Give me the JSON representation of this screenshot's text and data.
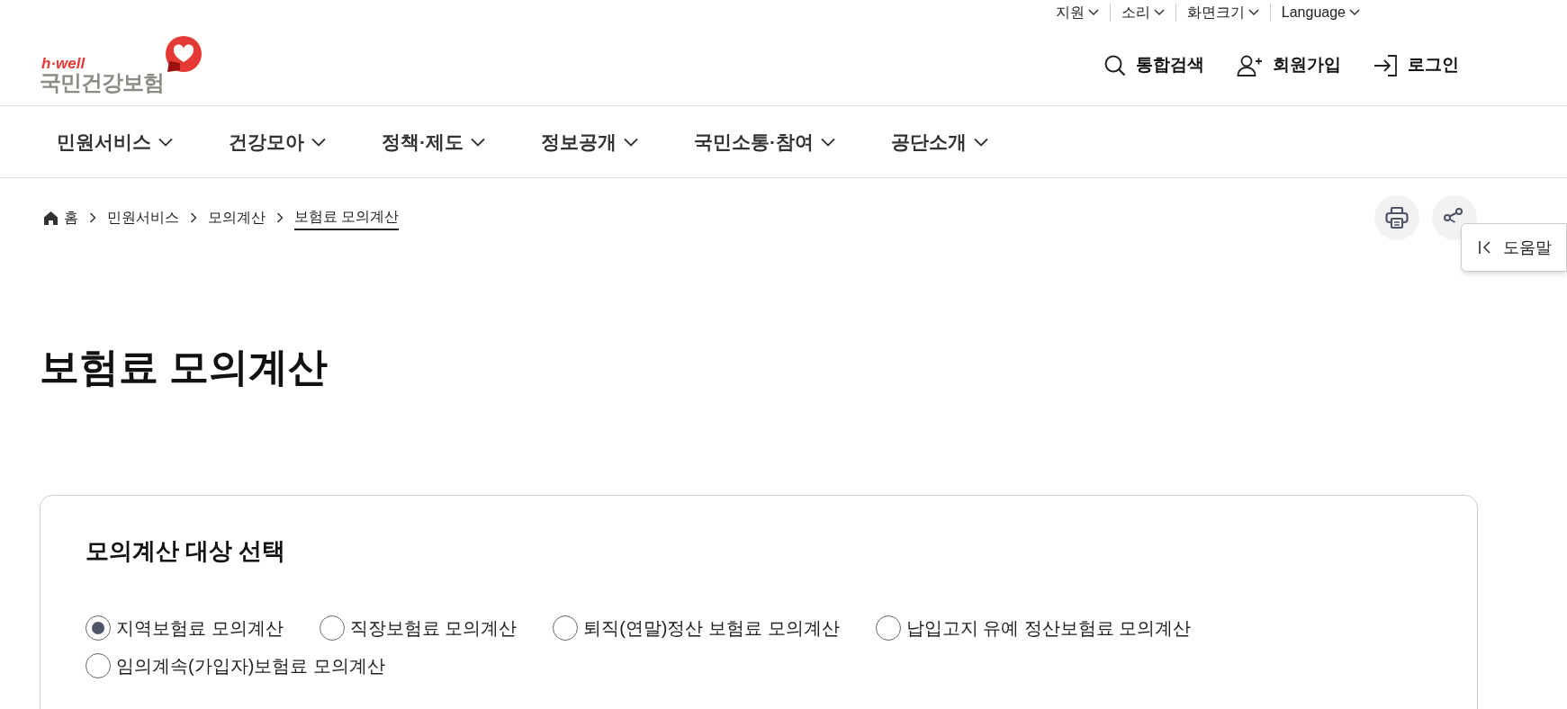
{
  "utility_menu": [
    {
      "label": "지원"
    },
    {
      "label": "소리"
    },
    {
      "label": "화면크기"
    },
    {
      "label": "Language"
    }
  ],
  "logo": {
    "tagline": "h·well",
    "name": "국민건강보험"
  },
  "header_actions": [
    {
      "kind": "search",
      "label": "통합검색"
    },
    {
      "kind": "signup",
      "label": "회원가입"
    },
    {
      "kind": "login",
      "label": "로그인"
    }
  ],
  "main_nav": [
    {
      "label": "민원서비스"
    },
    {
      "label": "건강모아"
    },
    {
      "label": "정책·제도"
    },
    {
      "label": "정보공개"
    },
    {
      "label": "국민소통·참여"
    },
    {
      "label": "공단소개"
    }
  ],
  "breadcrumb": [
    {
      "label": "홈",
      "current": false
    },
    {
      "label": "민원서비스",
      "current": false
    },
    {
      "label": "모의계산",
      "current": false
    },
    {
      "label": "보험료 모의계산",
      "current": true
    }
  ],
  "help_tab": {
    "label": "도움말"
  },
  "page_title": "보험료 모의계산",
  "selection_card": {
    "title": "모의계산 대상 선택",
    "options": [
      {
        "label": "지역보험료 모의계산",
        "selected": true
      },
      {
        "label": "직장보험료 모의계산",
        "selected": false
      },
      {
        "label": "퇴직(연말)정산 보험료 모의계산",
        "selected": false
      },
      {
        "label": "납입고지 유예 정산보험료 모의계산",
        "selected": false
      },
      {
        "label": "임의계속(가입자)보험료 모의계산",
        "selected": false
      }
    ]
  }
}
